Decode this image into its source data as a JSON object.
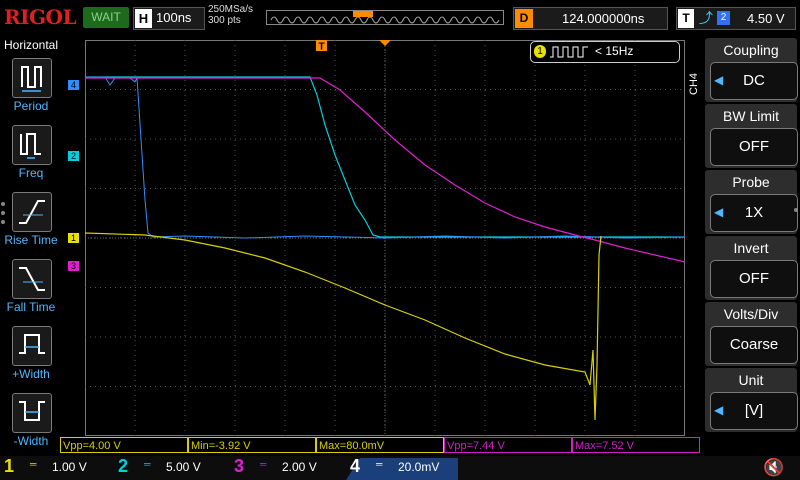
{
  "header": {
    "brand": "RIGOL",
    "run_status": "WAIT",
    "horizontal_key": "H",
    "timebase": "100ns",
    "sample_rate": "250MSa/s",
    "memory_depth": "300 pts",
    "delay_key": "D",
    "delay": "124.000000ns",
    "trigger_key": "T",
    "trigger_edge": "rising-edge-icon",
    "trigger_source": "2",
    "trigger_level": "4.50 V"
  },
  "left_panel": {
    "title": "Horizontal",
    "items": [
      {
        "label": "Period",
        "icon": "period-icon"
      },
      {
        "label": "Freq",
        "icon": "frequency-icon"
      },
      {
        "label": "Rise Time",
        "icon": "rise-time-icon"
      },
      {
        "label": "Fall Time",
        "icon": "fall-time-icon"
      },
      {
        "label": "+Width",
        "icon": "positive-width-icon"
      },
      {
        "label": "-Width",
        "icon": "negative-width-icon"
      }
    ]
  },
  "frequency_counter": {
    "channel": "1",
    "value": "< 15Hz"
  },
  "channel_markers": [
    {
      "id": "4",
      "color": "#2f8fff"
    },
    {
      "id": "2",
      "color": "#00cfe0"
    },
    {
      "id": "1",
      "color": "#e8e000"
    },
    {
      "id": "3",
      "color": "#e020d0"
    }
  ],
  "measurements": [
    {
      "text": "Vpp=4.00 V",
      "color": "#d8d000"
    },
    {
      "text": "Min=-3.92 V",
      "color": "#d8d000"
    },
    {
      "text": "Max=80.0mV",
      "color": "#d8d000"
    },
    {
      "text": "Vpp=7.44 V",
      "color": "#d020c8"
    },
    {
      "text": "Max=7.52 V",
      "color": "#d020c8"
    }
  ],
  "channels": [
    {
      "num": "1",
      "coupling": "═",
      "scale": "1.00 V",
      "color": "#e8e000"
    },
    {
      "num": "2",
      "coupling": "═",
      "scale": "5.00 V",
      "color": "#00cfe0"
    },
    {
      "num": "3",
      "coupling": "═",
      "scale": "2.00 V",
      "color": "#e020d0"
    },
    {
      "num": "4",
      "coupling": "═",
      "scale": "20.0mV",
      "color": "#2f8fff"
    }
  ],
  "right_menu": {
    "tag": "CH4",
    "items": [
      {
        "title": "Coupling",
        "value": "DC",
        "arrow": true
      },
      {
        "title": "BW Limit",
        "value": "OFF",
        "arrow": false
      },
      {
        "title": "Probe",
        "value": "1X",
        "arrow": true
      },
      {
        "title": "Invert",
        "value": "OFF",
        "arrow": false
      },
      {
        "title": "Volts/Div",
        "value": "Coarse",
        "arrow": false
      },
      {
        "title": "Unit",
        "value": "[V]",
        "arrow": true
      }
    ]
  },
  "speaker_icon": "speaker-muted-icon"
}
